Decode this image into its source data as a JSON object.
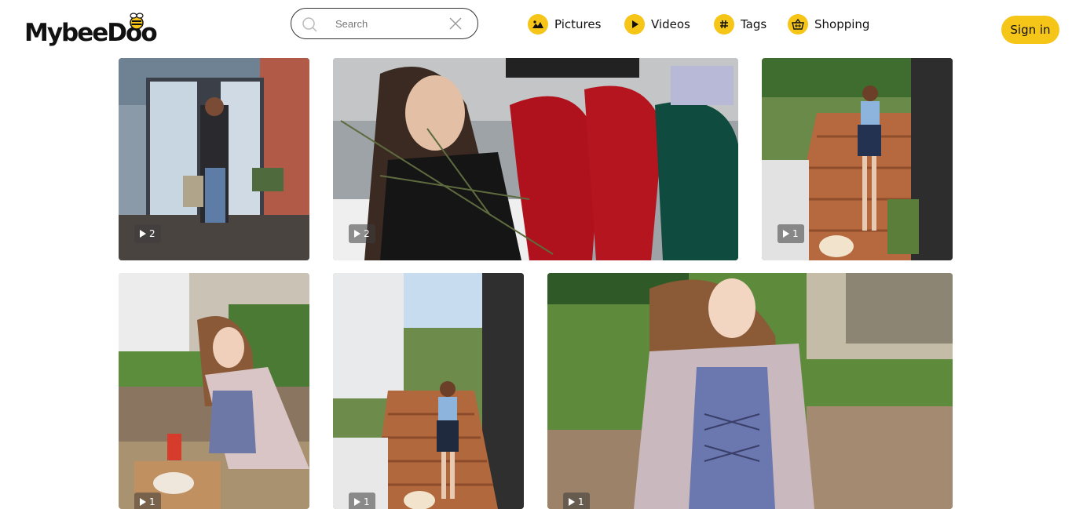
{
  "header": {
    "logo_text": "MybeeDoo",
    "search": {
      "placeholder": "Search",
      "value": ""
    },
    "nav": [
      {
        "label": "Pictures",
        "icon": "picture-icon"
      },
      {
        "label": "Videos",
        "icon": "play-icon"
      },
      {
        "label": "Tags",
        "icon": "hashtag-icon"
      },
      {
        "label": "Shopping",
        "icon": "basket-icon"
      }
    ],
    "signin_label": "Sign in"
  },
  "colors": {
    "accent": "#f5c518",
    "badge_bg": "#3c3c3c"
  },
  "gallery": [
    {
      "badge": "2",
      "badge_icon": "play-icon"
    },
    {
      "badge": "2",
      "badge_icon": "play-icon"
    },
    {
      "badge": "1",
      "badge_icon": "play-icon"
    },
    {
      "badge": "1",
      "badge_icon": "play-icon"
    },
    {
      "badge": "1",
      "badge_icon": "play-icon"
    },
    {
      "badge": "1",
      "badge_icon": "play-icon"
    }
  ]
}
